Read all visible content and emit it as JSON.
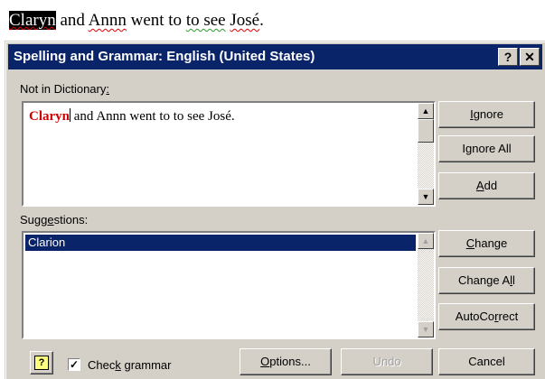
{
  "document": {
    "word_error": "Claryn",
    "text_1": " and ",
    "word_2": "Annn",
    "text_2": " went to ",
    "word_3": "to see",
    "text_3": " ",
    "word_4": "José",
    "text_4": "."
  },
  "dialog": {
    "title": "Spelling and Grammar: English (United States)",
    "help_glyph": "?",
    "close_glyph": "✕",
    "not_in_dictionary_label": "Not in Dictionary",
    "not_in_dictionary_label_accel": ":",
    "error_word": "Claryn",
    "sentence_rest": " and Annn went to to see José.",
    "suggestions_label_pre": "Sugg",
    "suggestions_label_accel": "e",
    "suggestions_label_post": "stions:",
    "suggestions": [
      "Clarion"
    ],
    "buttons": {
      "ignore": {
        "accel": "I",
        "rest": "gnore"
      },
      "ignore_all": {
        "pre": "I",
        "accel": "g",
        "rest": "nore All"
      },
      "add": {
        "accel": "A",
        "rest": "dd"
      },
      "change": {
        "accel": "C",
        "rest": "hange"
      },
      "change_all": {
        "pre": "Change A",
        "accel": "l",
        "rest": "l"
      },
      "autocorrect": {
        "pre": "AutoCo",
        "accel": "r",
        "rest": "rect"
      },
      "options": {
        "accel": "O",
        "rest": "ptions..."
      },
      "undo": "Undo",
      "cancel": "Cancel"
    },
    "check_grammar": {
      "pre": "Chec",
      "accel": "k",
      "rest": " grammar",
      "checked_glyph": "✓"
    },
    "office_help_glyph": "?",
    "scroll_up_glyph": "▲",
    "scroll_down_glyph": "▼"
  }
}
